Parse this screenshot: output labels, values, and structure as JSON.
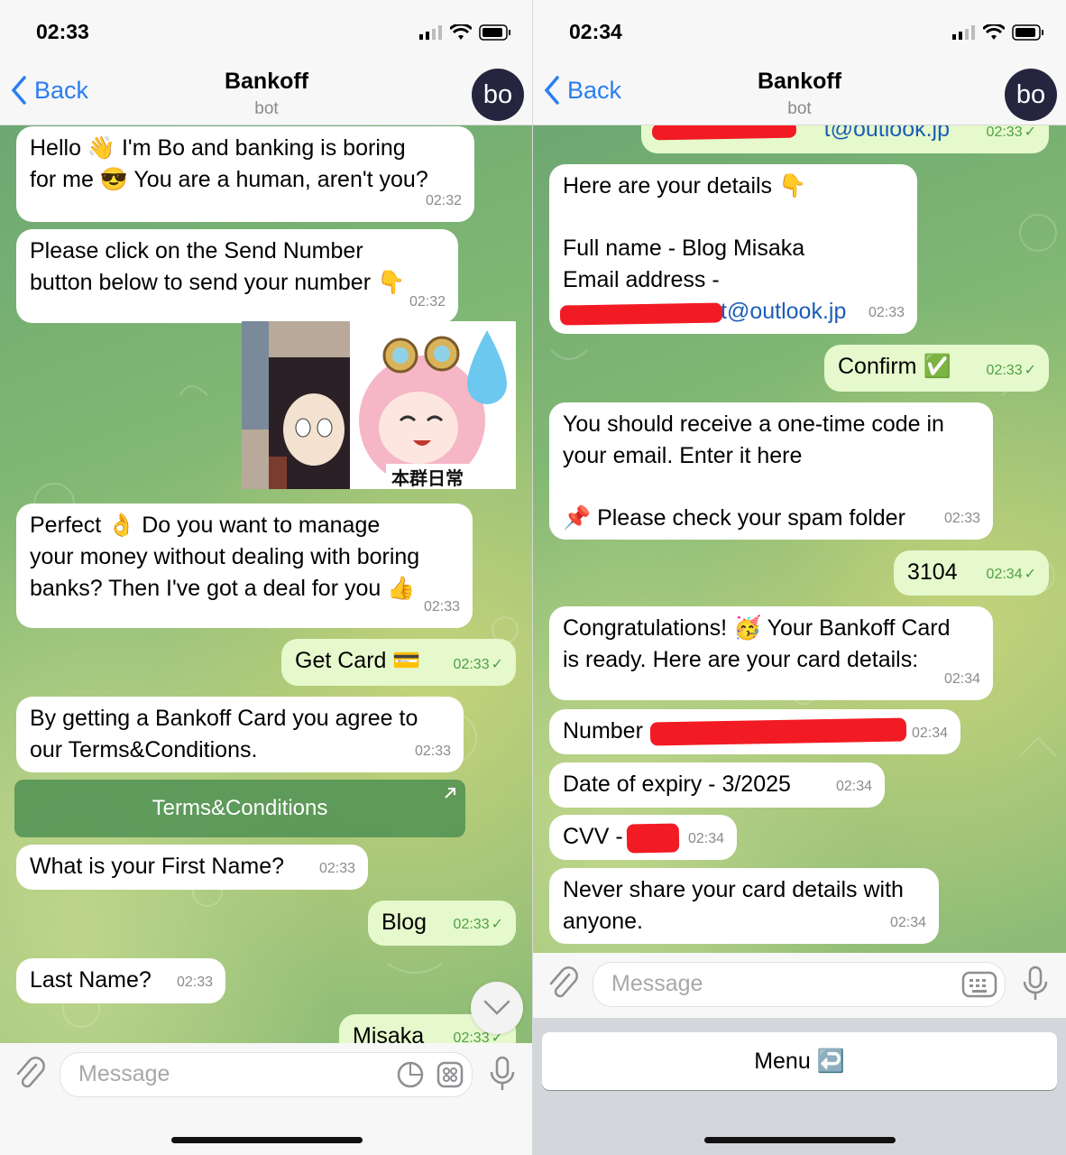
{
  "left": {
    "status_time": "02:33",
    "nav": {
      "back_label": "Back",
      "title": "Bankoff",
      "subtitle": "bot",
      "avatar": "bo"
    },
    "messages": {
      "m1": {
        "text_a": "Hello 👋 I'm Bo and banking is boring",
        "text_b": "for me 😎 You are a human, aren't you?",
        "time": "02:32"
      },
      "m2": {
        "text_a": "Please click on the Send Number",
        "text_b": "button below to send your number 👇",
        "time": "02:32"
      },
      "sticker_caption": "本群日常",
      "m3": {
        "text_a": "Perfect 👌 Do you want to manage",
        "text_b": "your money without dealing with boring",
        "text_c": "banks? Then I've got a deal for you 👍",
        "time": "02:33"
      },
      "m4": {
        "text": "Get Card 💳",
        "time": "02:33"
      },
      "m5": {
        "text_a": "By getting a Bankoff Card you agree to",
        "text_b": "our Terms&Conditions.",
        "time": "02:33"
      },
      "tc_button": "Terms&Conditions",
      "m6": {
        "text": "What is your First Name?",
        "time": "02:33"
      },
      "m7": {
        "text": "Blog",
        "time": "02:33"
      },
      "m8": {
        "text": "Last Name?",
        "time": "02:33"
      },
      "m9": {
        "text": "Misaka",
        "time": "02:33"
      }
    },
    "input_placeholder": "Message"
  },
  "right": {
    "status_time": "02:34",
    "nav": {
      "back_label": "Back",
      "title": "Bankoff",
      "subtitle": "bot",
      "avatar": "bo"
    },
    "messages": {
      "r0": {
        "text": "t@outlook.jp",
        "time": "02:33"
      },
      "r1": {
        "text_a": "Here are your details 👇",
        "text_b": "Full name - Blog  Misaka",
        "text_c": "Email address -",
        "text_d": "t@outlook.jp",
        "time": "02:33"
      },
      "r2": {
        "text": "Confirm ✅",
        "time": "02:33"
      },
      "r3": {
        "text_a": "You should receive a one-time code in",
        "text_b": "your email. Enter it here",
        "text_c": "📌 Please check your spam folder",
        "time": "02:33"
      },
      "r4": {
        "text": "3104",
        "time": "02:34"
      },
      "r5": {
        "text_a": "Congratulations! 🥳 Your Bankoff Card",
        "text_b": "is ready. Here are your card details:",
        "time": "02:34"
      },
      "r6": {
        "text": "Number",
        "time": "02:34"
      },
      "r7": {
        "text": "Date of expiry - 3/2025",
        "time": "02:34"
      },
      "r8": {
        "text": "CVV -",
        "time": "02:34"
      },
      "r9": {
        "text_a": "Never share your card details with",
        "text_b": "anyone.",
        "time": "02:34"
      }
    },
    "input_placeholder": "Message",
    "menu_button": "Menu ↩️"
  },
  "colors": {
    "accent": "#2a7ef0",
    "outgoing_bubble": "#e5f9cc",
    "incoming_bubble": "#ffffff",
    "avatar_bg": "#262540",
    "redaction": "#f21b24"
  },
  "icons": [
    "chevron-left-icon",
    "signal-icon",
    "wifi-icon",
    "battery-icon",
    "paperclip-icon",
    "sticker-icon",
    "grid-icon",
    "microphone-icon",
    "keyboard-icon",
    "chevron-down-icon",
    "external-link-icon"
  ]
}
